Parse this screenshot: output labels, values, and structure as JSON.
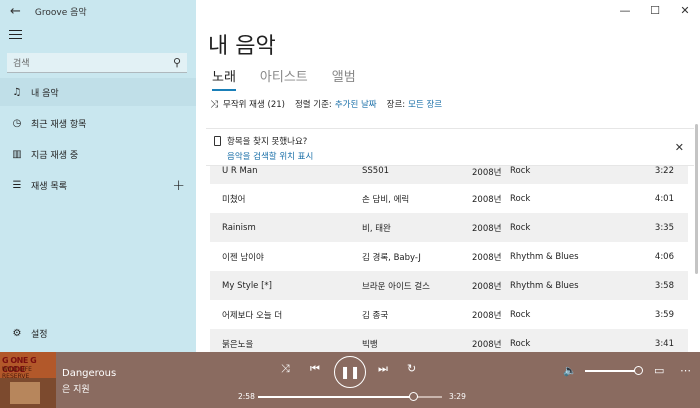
{
  "app": {
    "title": "Groove 음악"
  },
  "sidebar": {
    "search_placeholder": "검색",
    "items": [
      {
        "label": "내 음악",
        "icon": "music-note-icon"
      },
      {
        "label": "최근 재생 항목",
        "icon": "clock-icon"
      },
      {
        "label": "지금 재생 중",
        "icon": "bars-icon"
      },
      {
        "label": "재생 목록",
        "icon": "list-icon"
      }
    ],
    "settings_label": "설정"
  },
  "main": {
    "title": "내 음악",
    "tabs": [
      {
        "label": "노래",
        "active": true
      },
      {
        "label": "아티스트",
        "active": false
      },
      {
        "label": "앨범",
        "active": false
      }
    ],
    "toolbar": {
      "shuffle_label": "무작위 재생 (21)",
      "sort_prefix": "정렬 기준:",
      "sort_value": "추가된 날짜",
      "genre_prefix": "장르:",
      "genre_value": "모든 장르"
    },
    "notice": {
      "question": "항목을 찾지 못했나요?",
      "link": "음악을 검색할 위치 표시"
    },
    "songs": [
      {
        "title": "U R Man",
        "artist": "SS501",
        "year": "2008년",
        "genre": "Rock",
        "length": "3:22"
      },
      {
        "title": "미쳤어",
        "artist": "손 담비, 에릭",
        "year": "2008년",
        "genre": "Rock",
        "length": "4:01"
      },
      {
        "title": "Rainism",
        "artist": "비, 태완",
        "year": "2008년",
        "genre": "Rock",
        "length": "3:35"
      },
      {
        "title": "이젠 남이야",
        "artist": "김 경록, Baby-J",
        "year": "2008년",
        "genre": "Rhythm & Blues",
        "length": "4:06"
      },
      {
        "title": "My Style [*]",
        "artist": "브라운 아이드 걸스",
        "year": "2008년",
        "genre": "Rhythm & Blues",
        "length": "3:58"
      },
      {
        "title": "어제보다 오늘 더",
        "artist": "김 종국",
        "year": "2008년",
        "genre": "Rock",
        "length": "3:59"
      },
      {
        "title": "붉은노을",
        "artist": "빅뱅",
        "year": "2008년",
        "genre": "Rock",
        "length": "3:41"
      }
    ]
  },
  "player": {
    "track_title": "Dangerous",
    "artist": "은 지원",
    "album_text_1": "G ONE G CODE",
    "album_text_2": "WILD LIFE RESERVE",
    "current_time": "2:58",
    "total_time": "3:29",
    "progress": 0.85,
    "volume": 0.9
  }
}
